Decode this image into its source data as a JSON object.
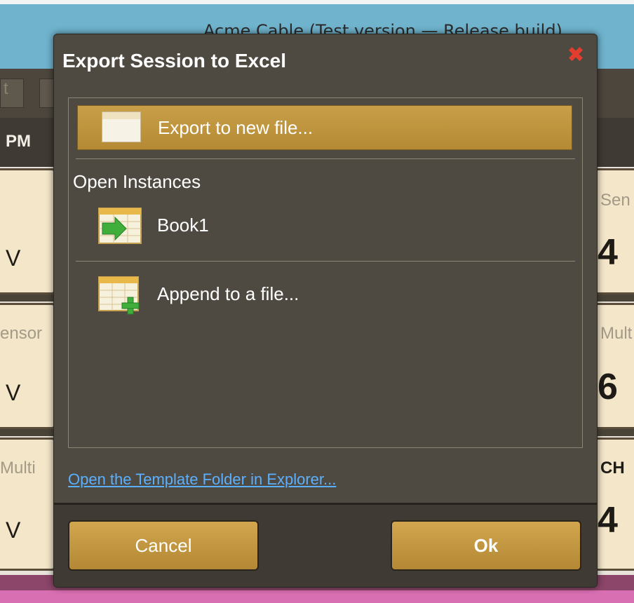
{
  "background": {
    "window_title": "Acme Cable (Test version — Release build)",
    "header_label": "PM",
    "tile_labels": [
      "Sen",
      "Mult",
      "Mult",
      "CH"
    ],
    "tile_values": [
      "4",
      "6",
      "4"
    ],
    "unit": "V",
    "left_partial_labels": [
      "ensor",
      "Multi"
    ]
  },
  "dialog": {
    "title": "Export Session to Excel",
    "export_new_label": "Export to new file...",
    "open_instances_label": "Open Instances",
    "instances": [
      "Book1"
    ],
    "append_label": "Append to a file...",
    "template_link": "Open the Template Folder in Explorer...",
    "cancel_label": "Cancel",
    "ok_label": "Ok"
  },
  "colors": {
    "accent": "#c89f48",
    "dialog_bg": "#4f4a41",
    "link": "#5ab0ff",
    "close": "#e23d2f"
  }
}
